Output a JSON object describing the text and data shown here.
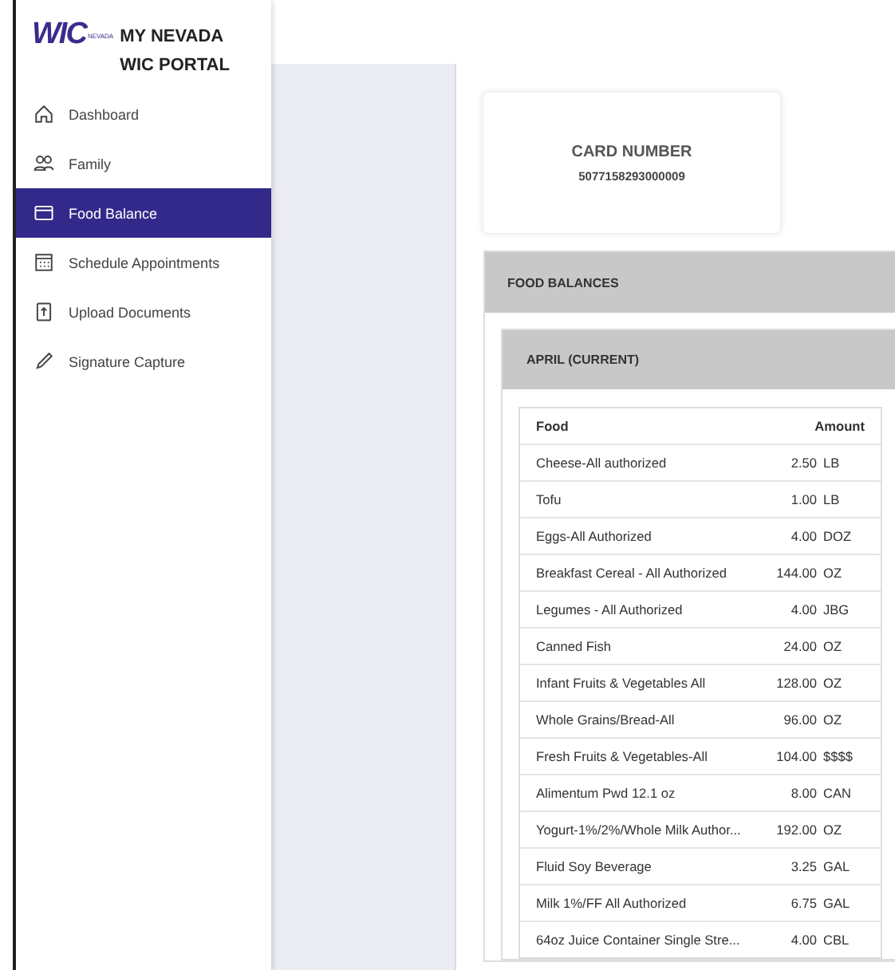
{
  "brand": {
    "logo_text": "WIC",
    "logo_small": "NEVADA",
    "title": "MY NEVADA WIC PORTAL"
  },
  "sidebar": {
    "items": [
      {
        "label": "Dashboard",
        "kind": "home",
        "selected": false
      },
      {
        "label": "Family",
        "kind": "people",
        "selected": false
      },
      {
        "label": "Food Balance",
        "kind": "card",
        "selected": true
      },
      {
        "label": "Schedule Appointments",
        "kind": "calendar",
        "selected": false
      },
      {
        "label": "Upload Documents",
        "kind": "upload",
        "selected": false
      },
      {
        "label": "Signature Capture",
        "kind": "pen",
        "selected": false
      }
    ]
  },
  "card": {
    "label": "CARD NUMBER",
    "number": "5077158293000009"
  },
  "food_balances": {
    "title": "FOOD BALANCES",
    "period": "APRIL (CURRENT)",
    "columns": [
      "Food",
      "Amount"
    ],
    "rows": [
      {
        "food": "Cheese-All authorized",
        "qty": "2.50",
        "unit": "LB"
      },
      {
        "food": "Tofu",
        "qty": "1.00",
        "unit": "LB"
      },
      {
        "food": "Eggs-All Authorized",
        "qty": "4.00",
        "unit": "DOZ"
      },
      {
        "food": "Breakfast Cereal - All Authorized",
        "qty": "144.00",
        "unit": "OZ"
      },
      {
        "food": "Legumes - All Authorized",
        "qty": "4.00",
        "unit": "JBG"
      },
      {
        "food": "Canned Fish",
        "qty": "24.00",
        "unit": "OZ"
      },
      {
        "food": "Infant Fruits & Vegetables All",
        "qty": "128.00",
        "unit": "OZ"
      },
      {
        "food": "Whole Grains/Bread-All",
        "qty": "96.00",
        "unit": "OZ"
      },
      {
        "food": "Fresh Fruits & Vegetables-All",
        "qty": "104.00",
        "unit": "$$$$"
      },
      {
        "food": "Alimentum Pwd 12.1 oz",
        "qty": "8.00",
        "unit": "CAN"
      },
      {
        "food": "Yogurt-1%/2%/Whole Milk Author...",
        "qty": "192.00",
        "unit": "OZ"
      },
      {
        "food": "Fluid Soy Beverage",
        "qty": "3.25",
        "unit": "GAL"
      },
      {
        "food": "Milk 1%/FF All Authorized",
        "qty": "6.75",
        "unit": "GAL"
      },
      {
        "food": "64oz Juice Container Single Stre...",
        "qty": "4.00",
        "unit": "CBL"
      }
    ]
  }
}
